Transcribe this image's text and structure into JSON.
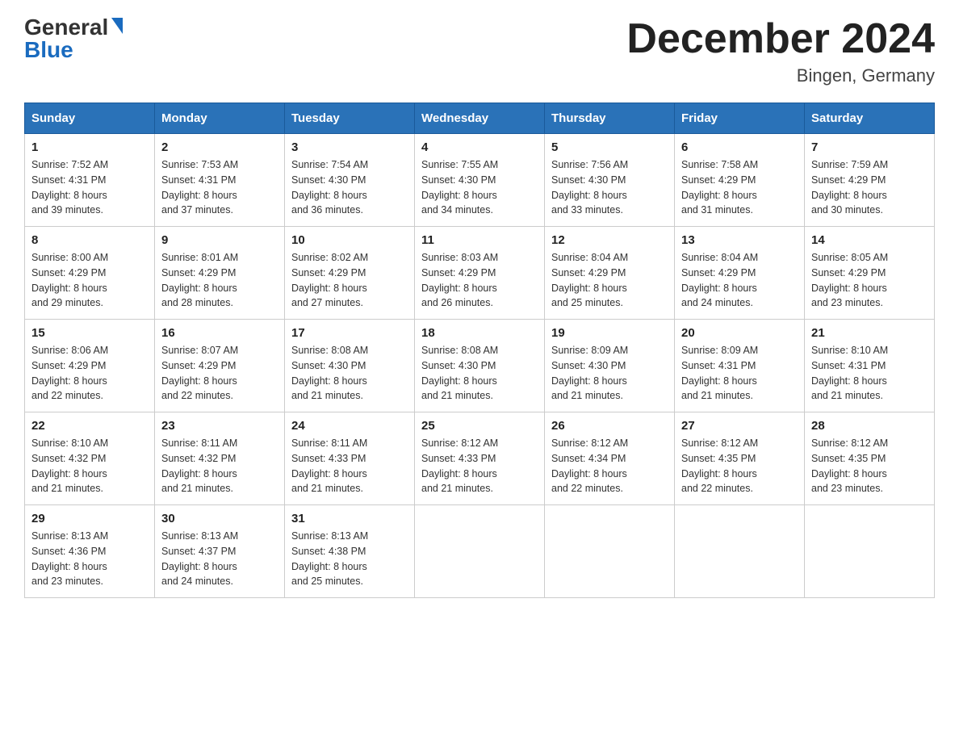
{
  "header": {
    "logo_general": "General",
    "logo_blue": "Blue",
    "month_title": "December 2024",
    "location": "Bingen, Germany"
  },
  "weekdays": [
    "Sunday",
    "Monday",
    "Tuesday",
    "Wednesday",
    "Thursday",
    "Friday",
    "Saturday"
  ],
  "weeks": [
    [
      {
        "day": "1",
        "sunrise": "7:52 AM",
        "sunset": "4:31 PM",
        "daylight": "8 hours and 39 minutes."
      },
      {
        "day": "2",
        "sunrise": "7:53 AM",
        "sunset": "4:31 PM",
        "daylight": "8 hours and 37 minutes."
      },
      {
        "day": "3",
        "sunrise": "7:54 AM",
        "sunset": "4:30 PM",
        "daylight": "8 hours and 36 minutes."
      },
      {
        "day": "4",
        "sunrise": "7:55 AM",
        "sunset": "4:30 PM",
        "daylight": "8 hours and 34 minutes."
      },
      {
        "day": "5",
        "sunrise": "7:56 AM",
        "sunset": "4:30 PM",
        "daylight": "8 hours and 33 minutes."
      },
      {
        "day": "6",
        "sunrise": "7:58 AM",
        "sunset": "4:29 PM",
        "daylight": "8 hours and 31 minutes."
      },
      {
        "day": "7",
        "sunrise": "7:59 AM",
        "sunset": "4:29 PM",
        "daylight": "8 hours and 30 minutes."
      }
    ],
    [
      {
        "day": "8",
        "sunrise": "8:00 AM",
        "sunset": "4:29 PM",
        "daylight": "8 hours and 29 minutes."
      },
      {
        "day": "9",
        "sunrise": "8:01 AM",
        "sunset": "4:29 PM",
        "daylight": "8 hours and 28 minutes."
      },
      {
        "day": "10",
        "sunrise": "8:02 AM",
        "sunset": "4:29 PM",
        "daylight": "8 hours and 27 minutes."
      },
      {
        "day": "11",
        "sunrise": "8:03 AM",
        "sunset": "4:29 PM",
        "daylight": "8 hours and 26 minutes."
      },
      {
        "day": "12",
        "sunrise": "8:04 AM",
        "sunset": "4:29 PM",
        "daylight": "8 hours and 25 minutes."
      },
      {
        "day": "13",
        "sunrise": "8:04 AM",
        "sunset": "4:29 PM",
        "daylight": "8 hours and 24 minutes."
      },
      {
        "day": "14",
        "sunrise": "8:05 AM",
        "sunset": "4:29 PM",
        "daylight": "8 hours and 23 minutes."
      }
    ],
    [
      {
        "day": "15",
        "sunrise": "8:06 AM",
        "sunset": "4:29 PM",
        "daylight": "8 hours and 22 minutes."
      },
      {
        "day": "16",
        "sunrise": "8:07 AM",
        "sunset": "4:29 PM",
        "daylight": "8 hours and 22 minutes."
      },
      {
        "day": "17",
        "sunrise": "8:08 AM",
        "sunset": "4:30 PM",
        "daylight": "8 hours and 21 minutes."
      },
      {
        "day": "18",
        "sunrise": "8:08 AM",
        "sunset": "4:30 PM",
        "daylight": "8 hours and 21 minutes."
      },
      {
        "day": "19",
        "sunrise": "8:09 AM",
        "sunset": "4:30 PM",
        "daylight": "8 hours and 21 minutes."
      },
      {
        "day": "20",
        "sunrise": "8:09 AM",
        "sunset": "4:31 PM",
        "daylight": "8 hours and 21 minutes."
      },
      {
        "day": "21",
        "sunrise": "8:10 AM",
        "sunset": "4:31 PM",
        "daylight": "8 hours and 21 minutes."
      }
    ],
    [
      {
        "day": "22",
        "sunrise": "8:10 AM",
        "sunset": "4:32 PM",
        "daylight": "8 hours and 21 minutes."
      },
      {
        "day": "23",
        "sunrise": "8:11 AM",
        "sunset": "4:32 PM",
        "daylight": "8 hours and 21 minutes."
      },
      {
        "day": "24",
        "sunrise": "8:11 AM",
        "sunset": "4:33 PM",
        "daylight": "8 hours and 21 minutes."
      },
      {
        "day": "25",
        "sunrise": "8:12 AM",
        "sunset": "4:33 PM",
        "daylight": "8 hours and 21 minutes."
      },
      {
        "day": "26",
        "sunrise": "8:12 AM",
        "sunset": "4:34 PM",
        "daylight": "8 hours and 22 minutes."
      },
      {
        "day": "27",
        "sunrise": "8:12 AM",
        "sunset": "4:35 PM",
        "daylight": "8 hours and 22 minutes."
      },
      {
        "day": "28",
        "sunrise": "8:12 AM",
        "sunset": "4:35 PM",
        "daylight": "8 hours and 23 minutes."
      }
    ],
    [
      {
        "day": "29",
        "sunrise": "8:13 AM",
        "sunset": "4:36 PM",
        "daylight": "8 hours and 23 minutes."
      },
      {
        "day": "30",
        "sunrise": "8:13 AM",
        "sunset": "4:37 PM",
        "daylight": "8 hours and 24 minutes."
      },
      {
        "day": "31",
        "sunrise": "8:13 AM",
        "sunset": "4:38 PM",
        "daylight": "8 hours and 25 minutes."
      },
      null,
      null,
      null,
      null
    ]
  ],
  "labels": {
    "sunrise": "Sunrise:",
    "sunset": "Sunset:",
    "daylight": "Daylight:"
  }
}
